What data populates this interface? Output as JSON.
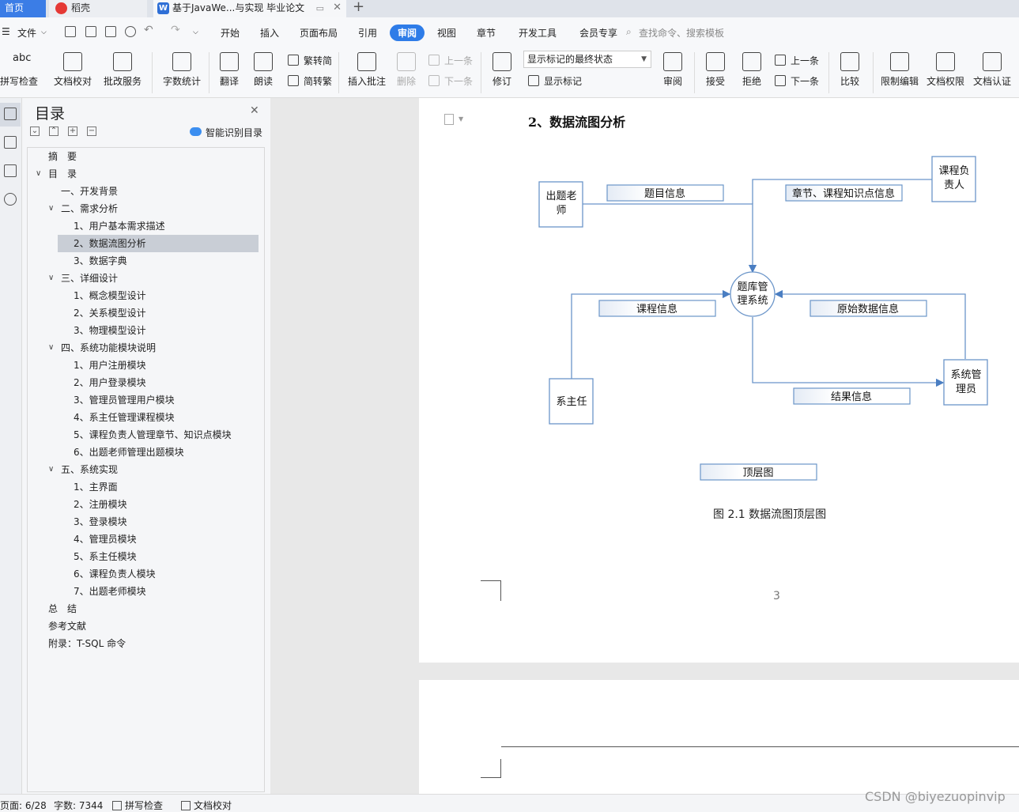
{
  "tabs": {
    "home": "首页",
    "daoke": "稻壳",
    "doc": "基于JavaWe...与实现 毕业论文",
    "doc_icon": "W",
    "add": "+"
  },
  "menubar": {
    "file": "文件",
    "items": [
      "开始",
      "插入",
      "页面布局",
      "引用",
      "审阅",
      "视图",
      "章节",
      "开发工具",
      "会员专享"
    ],
    "search": "查找命令、搜索模板"
  },
  "ribbon": {
    "spellcheck": "拼写检查",
    "doc_proof": "文档校对",
    "batch_service": "批改服务",
    "word_count": "字数统计",
    "translate": "翻译",
    "read_aloud": "朗读",
    "trad_to_simp": "繁转简",
    "simp_to_trad": "简转繁",
    "insert_comment": "插入批注",
    "delete": "删除",
    "prev_comment": "上一条",
    "next_comment": "下一条",
    "revise": "修订",
    "markup_state": "显示标记的最终状态",
    "show_markup": "显示标记",
    "review": "审阅",
    "accept": "接受",
    "reject": "拒绝",
    "prev_change": "上一条",
    "next_change": "下一条",
    "compare": "比较",
    "restrict_edit": "限制编辑",
    "doc_permission": "文档权限",
    "doc_certify": "文档认证"
  },
  "toc": {
    "title": "目录",
    "smart": "智能识别目录",
    "items": [
      {
        "label": "摘　要",
        "level": 0,
        "chev": ""
      },
      {
        "label": "目　录",
        "level": 0,
        "chev": "open"
      },
      {
        "label": "一、开发背景",
        "level": 1,
        "chev": ""
      },
      {
        "label": "二、需求分析",
        "level": 1,
        "chev": "open"
      },
      {
        "label": "1、用户基本需求描述",
        "level": 2,
        "chev": ""
      },
      {
        "label": "2、数据流图分析",
        "level": 2,
        "chev": "",
        "selected": true
      },
      {
        "label": "3、数据字典",
        "level": 2,
        "chev": ""
      },
      {
        "label": "三、详细设计",
        "level": 1,
        "chev": "open"
      },
      {
        "label": "1、概念模型设计",
        "level": 2,
        "chev": ""
      },
      {
        "label": "2、关系模型设计",
        "level": 2,
        "chev": ""
      },
      {
        "label": "3、物理模型设计",
        "level": 2,
        "chev": ""
      },
      {
        "label": "四、系统功能模块说明",
        "level": 1,
        "chev": "open"
      },
      {
        "label": "1、用户注册模块",
        "level": 2,
        "chev": ""
      },
      {
        "label": "2、用户登录模块",
        "level": 2,
        "chev": ""
      },
      {
        "label": "3、管理员管理用户模块",
        "level": 2,
        "chev": ""
      },
      {
        "label": "4、系主任管理课程模块",
        "level": 2,
        "chev": ""
      },
      {
        "label": "5、课程负责人管理章节、知识点模块",
        "level": 2,
        "chev": ""
      },
      {
        "label": "6、出题老师管理出题模块",
        "level": 2,
        "chev": ""
      },
      {
        "label": "五、系统实现",
        "level": 1,
        "chev": "open"
      },
      {
        "label": "1、主界面",
        "level": 2,
        "chev": ""
      },
      {
        "label": "2、注册模块",
        "level": 2,
        "chev": ""
      },
      {
        "label": "3、登录模块",
        "level": 2,
        "chev": ""
      },
      {
        "label": "4、管理员模块",
        "level": 2,
        "chev": ""
      },
      {
        "label": "5、系主任模块",
        "level": 2,
        "chev": ""
      },
      {
        "label": "6、课程负责人模块",
        "level": 2,
        "chev": ""
      },
      {
        "label": "7、出题老师模块",
        "level": 2,
        "chev": ""
      },
      {
        "label": "总　结",
        "level": 0,
        "chev": ""
      },
      {
        "label": "参考文献",
        "level": 0,
        "chev": ""
      },
      {
        "label": "附录：T-SQL 命令",
        "level": 0,
        "chev": ""
      }
    ]
  },
  "document": {
    "heading": "2、数据流图分析",
    "diagram": {
      "entity_teacher": [
        "出题老",
        "师"
      ],
      "entity_course_owner": [
        "课程负",
        "责人"
      ],
      "entity_dept_head": "系主任",
      "entity_admin": [
        "系统管",
        "理员"
      ],
      "process": [
        "题库管",
        "理系统"
      ],
      "flow_question_info": "题目信息",
      "flow_chapter_info": "章节、课程知识点信息",
      "flow_course_info": "课程信息",
      "flow_raw_data": "原始数据信息",
      "flow_result": "结果信息",
      "diagram_label": "顶层图"
    },
    "caption": "图 2.1  数据流图顶层图",
    "page_number": "3"
  },
  "statusbar": {
    "page": "页面: 6/28",
    "words": "字数: 7344",
    "spellcheck": "拼写检查",
    "proof": "文档校对"
  },
  "watermark": "CSDN @biyezuopinvip"
}
